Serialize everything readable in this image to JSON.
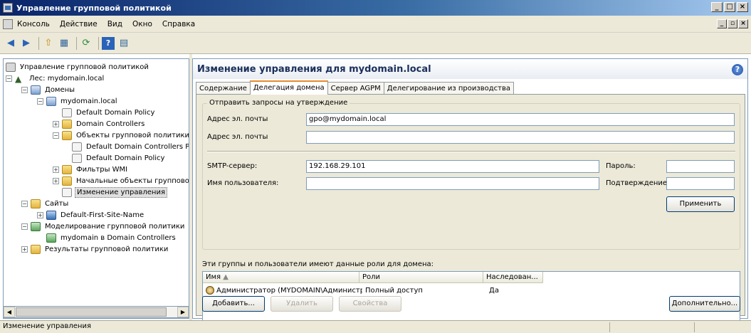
{
  "window": {
    "title": "Управление групповой политикой",
    "controls": [
      "_",
      "□",
      "×"
    ]
  },
  "menu": {
    "items": [
      "Консоль",
      "Действие",
      "Вид",
      "Окно",
      "Справка"
    ],
    "mdi_controls": [
      "_",
      "▫",
      "×"
    ]
  },
  "toolbar": {
    "icons": [
      "back-icon",
      "forward-icon",
      "up-folder-icon",
      "show-hide-tree-icon",
      "refresh-icon",
      "help-icon",
      "properties-icon"
    ],
    "glyphs": [
      "◀",
      "▶",
      "⇧",
      "▦",
      "⟳",
      "?",
      "▤"
    ]
  },
  "tree": {
    "root": "Управление групповой политикой",
    "forest": "Лес: mydomain.local",
    "domains": "Домены",
    "domain": "mydomain.local",
    "default_domain_policy": "Default Domain Policy",
    "domain_controllers": "Domain Controllers",
    "gpo_objects": "Объекты групповой политики",
    "default_dc_policy": "Default Domain Controllers Policy",
    "default_domain_policy_2": "Default Domain Policy",
    "wmi_filters": "Фильтры WMI",
    "starter_gpos": "Начальные объекты групповой пол",
    "change_control": "Изменение управления",
    "sites": "Сайты",
    "default_site": "Default-First-Site-Name",
    "modeling": "Моделирование групповой политики",
    "modeling_item": "mydomain в Domain Controllers",
    "results": "Результаты групповой политики"
  },
  "right": {
    "title": "Изменение управления для mydomain.local",
    "tabs": [
      "Содержание",
      "Делегация домена",
      "Сервер AGPM",
      "Делегирование из производства"
    ],
    "active_tab_index": 1,
    "group_title": "Отправить запросы на утверждение",
    "from_label": "Адрес эл. почты",
    "from_value": "gpo@mydomain.local",
    "to_label": "Адрес эл. почты",
    "to_value": "",
    "smtp_label": "SMTP-сервер:",
    "smtp_value": "192.168.29.101",
    "user_label": "Имя пользователя:",
    "user_value": "",
    "password_label": "Пароль:",
    "password_value": "",
    "confirm_label": "Подтверждение:",
    "confirm_value": "",
    "apply_button": "Применить",
    "roles_label": "Эти группы и пользователи имеют данные роли для домена:",
    "columns": [
      "Имя",
      "Роли",
      "Наследован..."
    ],
    "rows": [
      {
        "name": "Администратор (MYDOMAIN\\Администр...",
        "role": "Полный доступ",
        "inherited": "Да"
      }
    ],
    "add_button": "Добавить...",
    "remove_button": "Удалить",
    "properties_button": "Свойства",
    "advanced_button": "Дополнительно..."
  },
  "statusbar": {
    "text": "Изменение управления"
  }
}
